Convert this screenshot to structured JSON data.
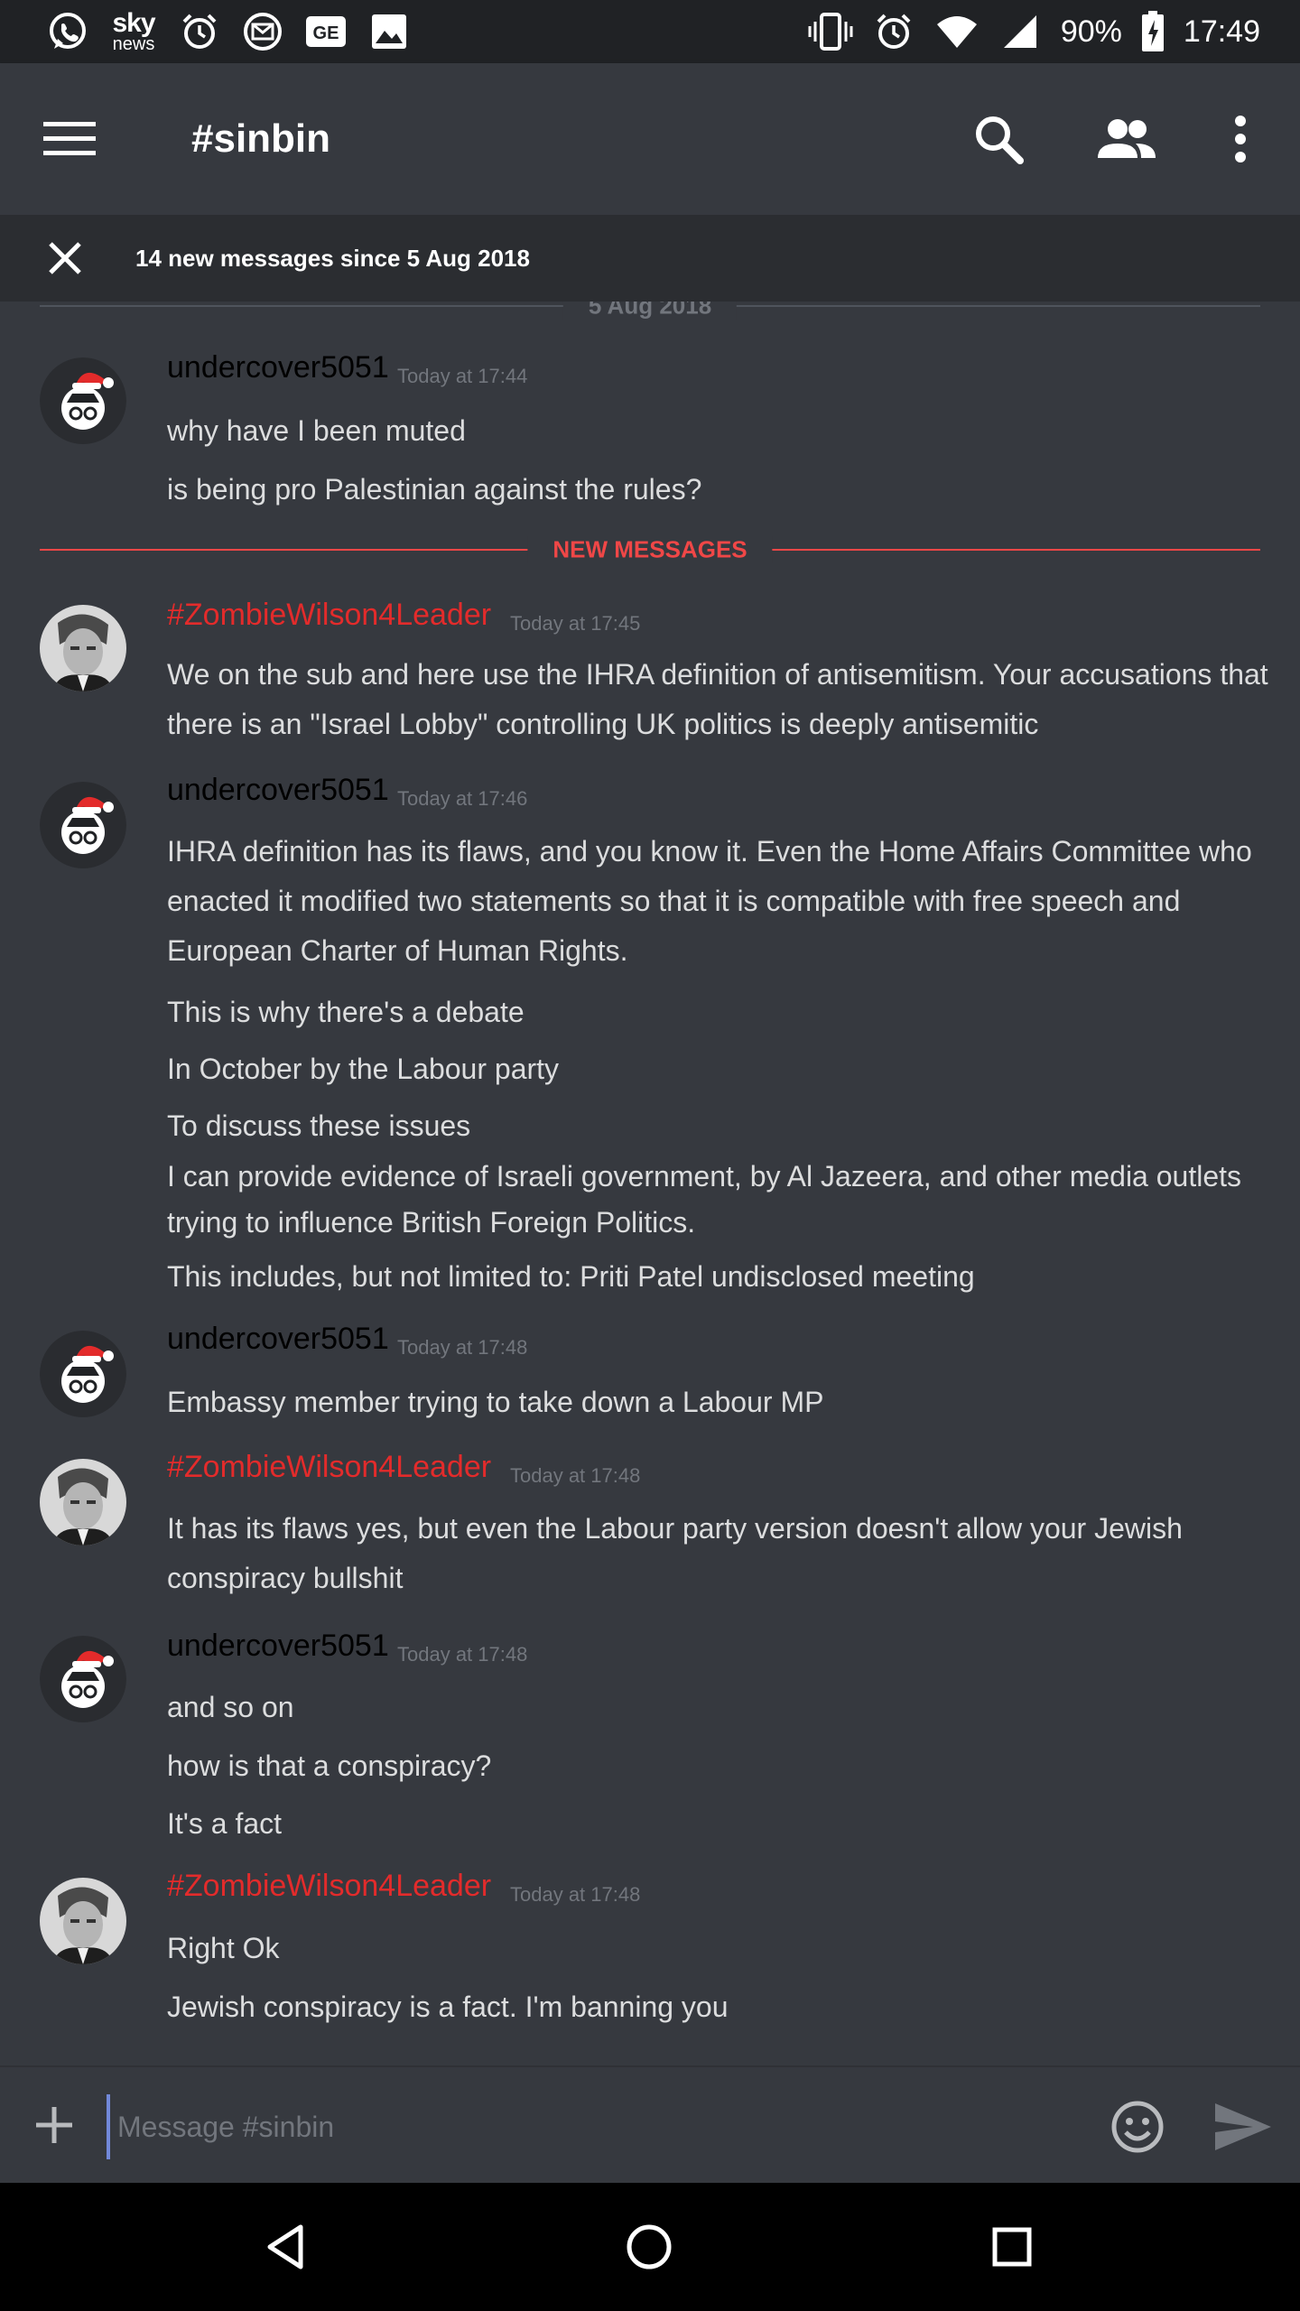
{
  "status_bar": {
    "sky_top": "sky",
    "sky_bottom": "news",
    "ge": "GE",
    "battery": "90%",
    "time": "17:49"
  },
  "header": {
    "channel": "#sinbin",
    "icons": [
      "menu-icon",
      "search-icon",
      "members-icon",
      "more-icon"
    ]
  },
  "banner": {
    "text": "14 new messages since 5 Aug 2018"
  },
  "date_divider": "5 Aug 2018",
  "new_divider": "NEW MESSAGES",
  "groups": [
    {
      "author": "undercover5051",
      "time": "Today at 17:44",
      "lines": [
        "why have I been muted",
        "is being pro Palestinian against the rules?"
      ]
    },
    {
      "author": "#ZombieWilson4Leader",
      "time": "Today at 17:45",
      "lines": [
        "We on the sub and here use the IHRA definition of antisemitism. Your accusations that there is an \"Israel Lobby\" controlling UK politics is deeply antisemitic"
      ]
    },
    {
      "author": "undercover5051",
      "time": "Today at 17:46",
      "lines": [
        "IHRA definition has its flaws, and you know it. Even the Home Affairs Committee who enacted it modified two statements so that it is compatible with free speech and European Charter of Human Rights.",
        "This is why there's a debate",
        "In October by the Labour party",
        "To discuss these issues",
        "I can provide evidence of Israeli government, by Al Jazeera, and other media outlets trying to influence British Foreign Politics.",
        "This includes, but not limited to: Priti Patel undisclosed meeting"
      ]
    },
    {
      "author": "undercover5051",
      "time": "Today at 17:48",
      "lines": [
        "Embassy member trying to take down a Labour MP"
      ]
    },
    {
      "author": "#ZombieWilson4Leader",
      "time": "Today at 17:48",
      "lines": [
        "It has its flaws yes, but even the Labour party version doesn't allow your Jewish conspiracy bullshit"
      ]
    },
    {
      "author": "undercover5051",
      "time": "Today at 17:48",
      "lines": [
        "and so on",
        "how is that a conspiracy?",
        "It's a fact"
      ]
    },
    {
      "author": "#ZombieWilson4Leader",
      "time": "Today at 17:48",
      "lines": [
        "Right Ok",
        "Jewish conspiracy is a fact. I'm banning you"
      ]
    }
  ],
  "input": {
    "placeholder": "Message #sinbin"
  },
  "colors": {
    "background": "#36393f",
    "new_messages_red": "#f04747",
    "mod_name_red": "#e32b2b",
    "timestamp_gray": "#72767d",
    "accent": "#7289da"
  }
}
